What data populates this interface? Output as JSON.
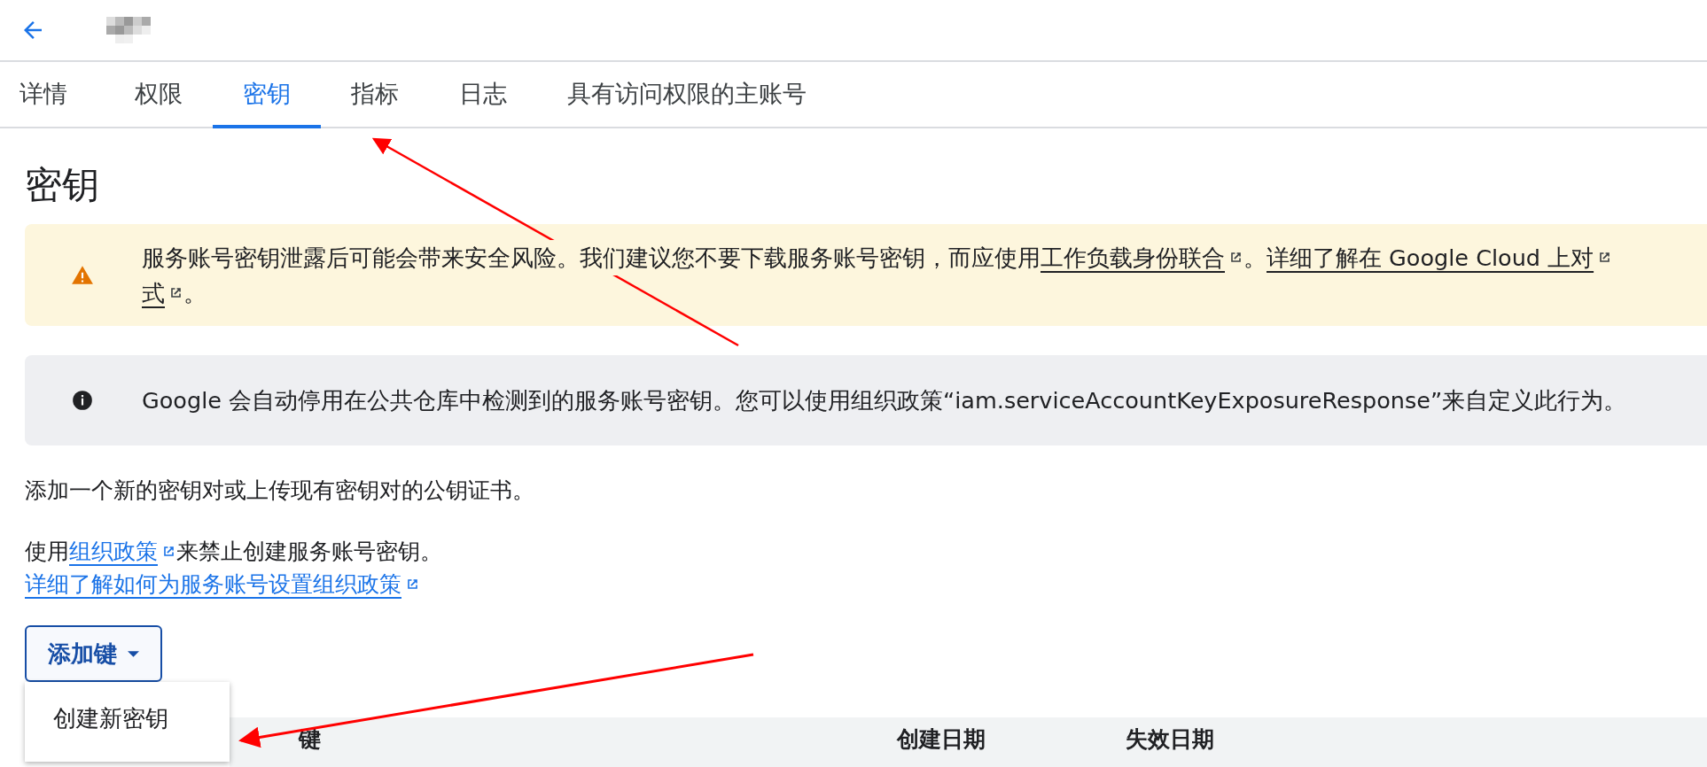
{
  "tabs": [
    {
      "label": "详情",
      "selected": false
    },
    {
      "label": "权限",
      "selected": false
    },
    {
      "label": "密钥",
      "selected": true
    },
    {
      "label": "指标",
      "selected": false
    },
    {
      "label": "日志",
      "selected": false
    },
    {
      "label": "具有访问权限的主账号",
      "selected": false
    }
  ],
  "heading": "密钥",
  "warning": {
    "lines": [
      [
        {
          "kind": "text",
          "text": "服务账号密钥泄露后可能会带来安全风险。我们建议您不要下载服务账号密钥，而应使用"
        },
        {
          "kind": "link",
          "text": "工作负载身份联合"
        },
        {
          "kind": "text",
          "text": "。"
        },
        {
          "kind": "link",
          "text": "详细了解在 Google Cloud 上对"
        }
      ],
      [
        {
          "kind": "link",
          "text": "式"
        },
        {
          "kind": "text",
          "text": "。"
        }
      ]
    ]
  },
  "info": {
    "lines": [
      [
        {
          "kind": "text",
          "text": "Google 会自动停用在公共仓库中检测到的服务账号密钥。您可以使用组织政策“iam.serviceAccountKeyExposureResponse”来自定义此行为。"
        }
      ]
    ]
  },
  "description": "添加一个新的密钥对或上传现有密钥对的公钥证书。",
  "policy_line": [
    {
      "kind": "text",
      "text": "使用"
    },
    {
      "kind": "link",
      "text": "组织政策"
    },
    {
      "kind": "text",
      "text": "来禁止创建服务账号密钥。"
    }
  ],
  "learn_link": "详细了解如何为服务账号设置组织政策",
  "add_button": {
    "label": "添加键",
    "expanded": true
  },
  "menu": {
    "items": [
      {
        "label": "创建新密钥"
      }
    ]
  },
  "table": {
    "columns": [
      "键",
      "创建日期",
      "失效日期"
    ]
  }
}
